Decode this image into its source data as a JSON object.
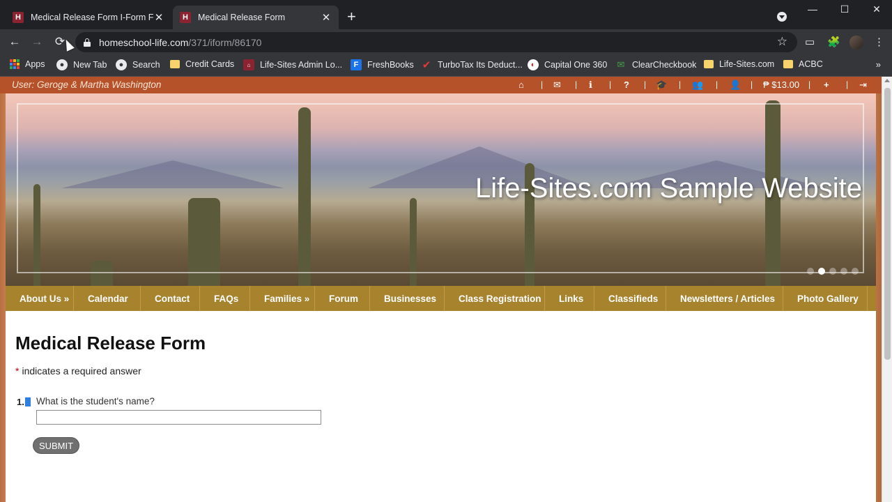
{
  "browser": {
    "tabs": [
      {
        "title": "Medical Release Form I-Form Fiel",
        "favicon": "H",
        "active": false
      },
      {
        "title": "Medical Release Form",
        "favicon": "H",
        "active": true
      }
    ],
    "new_tab": "+",
    "window_controls": {
      "minimize": "—",
      "maximize": "☐",
      "close": "✕"
    },
    "nav": {
      "back": "←",
      "forward": "→",
      "reload": "⟳"
    },
    "url_host": "homeschool-life.com",
    "url_path": "/371/iform/86170",
    "bookmark_star": "☆",
    "extensions": {
      "ext1": "▭",
      "puzzle": "🧩",
      "menu": "⋮"
    }
  },
  "bookmarks": [
    {
      "label": "Apps",
      "icon": "apps-icon"
    },
    {
      "label": "New Tab",
      "icon": "globe-icon"
    },
    {
      "label": "Search",
      "icon": "globe-icon"
    },
    {
      "label": "Credit Cards",
      "icon": "folder-icon"
    },
    {
      "label": "Life-Sites Admin Lo...",
      "icon": "hsl-icon"
    },
    {
      "label": "FreshBooks",
      "icon": "freshbooks-icon"
    },
    {
      "label": "TurboTax Its Deduct...",
      "icon": "turbotax-icon"
    },
    {
      "label": "Capital One 360",
      "icon": "capitalone-icon"
    },
    {
      "label": "ClearCheckbook",
      "icon": "clearcheckbook-icon"
    },
    {
      "label": "Life-Sites.com",
      "icon": "folder-icon"
    },
    {
      "label": "ACBC",
      "icon": "folder-icon"
    }
  ],
  "bookmarks_more": "»",
  "userbar": {
    "user_label": "User: Geroge & Martha Washington",
    "icons": [
      "home-icon",
      "mail-icon",
      "info-icon",
      "help-icon",
      "graduation-cap-icon",
      "group-icon",
      "user-icon"
    ],
    "glyphs": {
      "home": "⌂",
      "mail": "✉",
      "info": "ℹ",
      "help": "?",
      "cap": "🎓",
      "group": "👥",
      "user": "👤",
      "add_user": "+",
      "logout": "⇥"
    },
    "balance": "$13.00"
  },
  "banner": {
    "title": "Life-Sites.com Sample Website"
  },
  "mainnav": [
    "About Us »",
    "Calendar",
    "Contact",
    "FAQs",
    "Families »",
    "Forum",
    "Businesses",
    "Class Registration",
    "Links",
    "Classifieds",
    "Newsletters / Articles",
    "Photo Gallery"
  ],
  "form": {
    "title": "Medical Release Form",
    "required_star": "*",
    "required_note": "indicates a required answer",
    "question_number": "1.",
    "question_text": "What is the student's name?",
    "answer_value": "",
    "submit_label": "SUBMIT"
  },
  "colors": {
    "userbar": "#b5522a",
    "nav": "#a8832e",
    "tab_favicon": "#8b2430"
  }
}
